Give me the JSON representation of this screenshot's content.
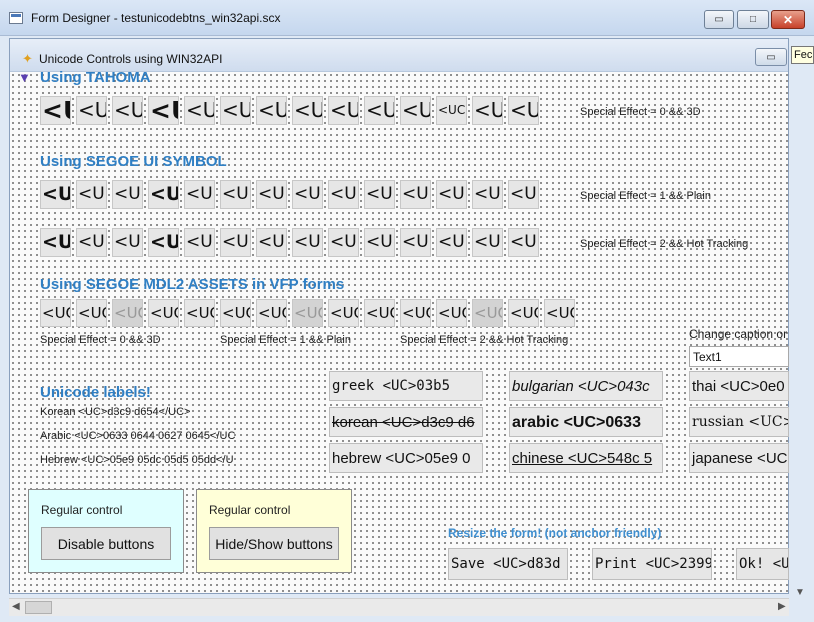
{
  "window": {
    "title": "Form Designer - testunicodebtns_win32api.scx"
  },
  "form": {
    "title": "Unicode Controls using WIN32API"
  },
  "tooltip": "Fec",
  "sections": {
    "tahoma": "Using TAHOMA",
    "segoe_symbol": "Using SEGOE UI SYMBOL",
    "segoe_mdl2": "Using SEGOE MDL2 ASSETS in VFP forms",
    "unicode_labels": "Unicode labels!"
  },
  "tahoma_row": [
    "<U",
    "<U",
    "<U",
    "<U",
    "<U",
    "<U",
    "<U",
    "<U",
    "<U",
    "<U",
    "<U",
    "<UC",
    "<U",
    "<U"
  ],
  "segoe_row1": [
    "<U",
    "<U",
    "<U",
    "<U",
    "<U",
    "<U",
    "<U",
    "<U",
    "<U",
    "<U",
    "<U",
    "<U",
    "<U",
    "<U"
  ],
  "segoe_row2": [
    "<U",
    "<U",
    "<U",
    "<U",
    "<U",
    "<U",
    "<U",
    "<U",
    "<U",
    "<U",
    "<U",
    "<U",
    "<U",
    "<U"
  ],
  "mdl_row": [
    "<UC",
    "<UC",
    "<UC",
    "<UC",
    "<UC",
    "<UC",
    "<UC",
    "<UC",
    "<UC",
    "<UC",
    "<UC",
    "<UC",
    "<UC",
    "<UC",
    "<UC"
  ],
  "effects": {
    "tahoma": "Special Effect = 0 && 3D",
    "segoe1": "Special Effect = 1 && Plain",
    "segoe2": "Special Effect = 2 && Hot Tracking",
    "mdl_0": "Special Effect = 0 && 3D",
    "mdl_1": "Special Effect = 1 && Plain",
    "mdl_2": "Special Effect = 2 && Hot Tracking"
  },
  "change_caption_label": "Change caption or",
  "text1_value": "Text1",
  "labels": {
    "korean": "Korean <UC>d3c9 d654</UC>",
    "arabic": "Arabic <UC>0633 0644 0627 0645</UC",
    "hebrew": "Hebrew <UC>05e9 05dc 05d5 05dd</U"
  },
  "textboxes": {
    "greek": "greek <UC>03b5",
    "korean": "korean <UC>d3c9 d6",
    "hebrew": "hebrew <UC>05e9 0",
    "bulgarian": "bulgarian <UC>043c",
    "arabic": "arabic <UC>0633",
    "chinese": "chinese <UC>548c 5",
    "thai": "thai <UC>0e0",
    "russian": "russian <UC>0",
    "japanese": "japanese <UC"
  },
  "panels": {
    "left_label": "Regular control",
    "left_button": "Disable buttons",
    "right_label": "Regular control",
    "right_button": "Hide/Show buttons"
  },
  "resize_note": "Resize the form! (not anchor friendly)",
  "bottom_buttons": {
    "save": "Save <UC>d83d",
    "print": "Print <UC>2399",
    "ok": "Ok! <U"
  }
}
